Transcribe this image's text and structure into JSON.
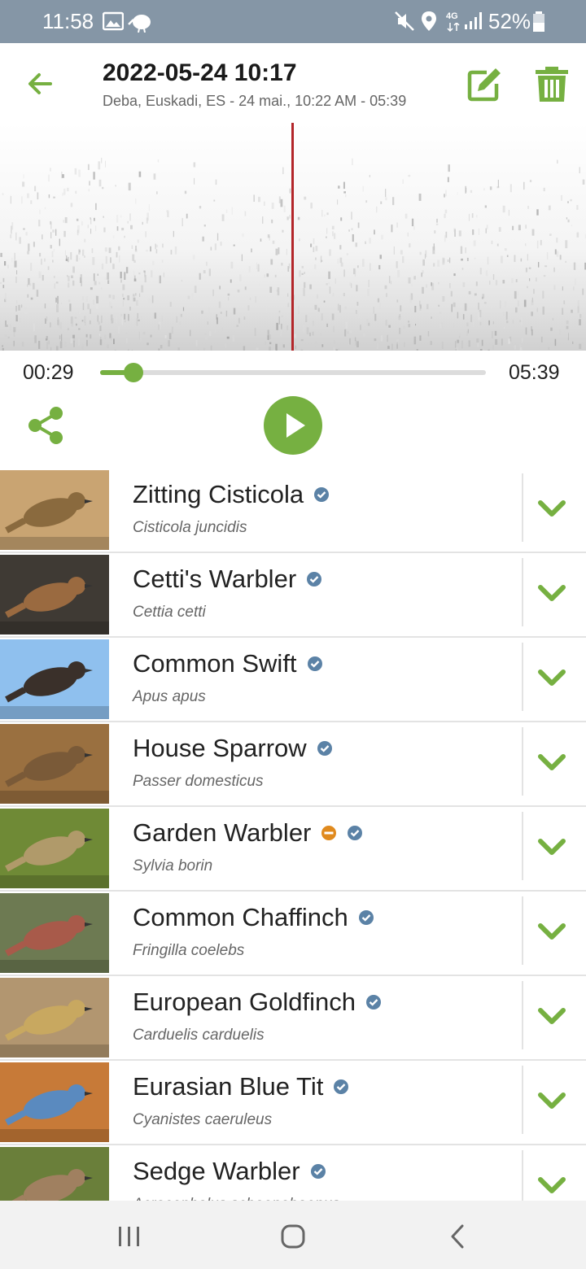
{
  "status_bar": {
    "time": "11:58",
    "network": "4G",
    "battery": "52%",
    "icons": [
      "gallery-icon",
      "kiwi-app-icon",
      "mute-icon",
      "location-icon",
      "data-arrows-icon",
      "signal-icon",
      "battery-icon"
    ]
  },
  "header": {
    "title": "2022-05-24 10:17",
    "subtitle": "Deba, Euskadi, ES - 24 mai., 10:22 AM - 05:39",
    "icons": [
      "back-arrow-icon",
      "edit-icon",
      "trash-icon"
    ]
  },
  "player": {
    "current_time": "00:29",
    "total_time": "05:39",
    "progress_fraction": 0.086
  },
  "colors": {
    "accent": "#76b041",
    "statusbar": "#8596a6",
    "playhead": "#b3262a",
    "verified_badge": "#5b82a6",
    "warning_badge": "#e08a1e"
  },
  "species": [
    {
      "common": "Zitting Cisticola",
      "scientific": "Cisticola juncidis",
      "badges": [
        "verified"
      ],
      "img": {
        "bg": "#c9a472",
        "bird": "#8a6a3e"
      }
    },
    {
      "common": "Cetti's Warbler",
      "scientific": "Cettia cetti",
      "badges": [
        "verified"
      ],
      "img": {
        "bg": "#3f3a34",
        "bird": "#9a6a40"
      }
    },
    {
      "common": "Common Swift",
      "scientific": "Apus apus",
      "badges": [
        "verified"
      ],
      "img": {
        "bg": "#8fc0ee",
        "bird": "#3a302a"
      }
    },
    {
      "common": "House Sparrow",
      "scientific": "Passer domesticus",
      "badges": [
        "verified"
      ],
      "img": {
        "bg": "#9a7040",
        "bird": "#7a5a38"
      }
    },
    {
      "common": "Garden Warbler",
      "scientific": "Sylvia borin",
      "badges": [
        "warning",
        "verified"
      ],
      "img": {
        "bg": "#6f8a36",
        "bird": "#b09a6a"
      }
    },
    {
      "common": "Common Chaffinch",
      "scientific": "Fringilla coelebs",
      "badges": [
        "verified"
      ],
      "img": {
        "bg": "#6d7a52",
        "bird": "#a85a4a"
      }
    },
    {
      "common": "European Goldfinch",
      "scientific": "Carduelis carduelis",
      "badges": [
        "verified"
      ],
      "img": {
        "bg": "#b29670",
        "bird": "#c8a860"
      }
    },
    {
      "common": "Eurasian Blue Tit",
      "scientific": "Cyanistes caeruleus",
      "badges": [
        "verified"
      ],
      "img": {
        "bg": "#c77a38",
        "bird": "#5a8abf"
      }
    },
    {
      "common": "Sedge Warbler",
      "scientific": "Acrocephalus schoenobaenus",
      "badges": [
        "verified"
      ],
      "img": {
        "bg": "#6a7f3a",
        "bird": "#a08060"
      }
    }
  ],
  "nav_bar": {
    "icons": [
      "recents-icon",
      "home-icon",
      "back-nav-icon"
    ]
  }
}
